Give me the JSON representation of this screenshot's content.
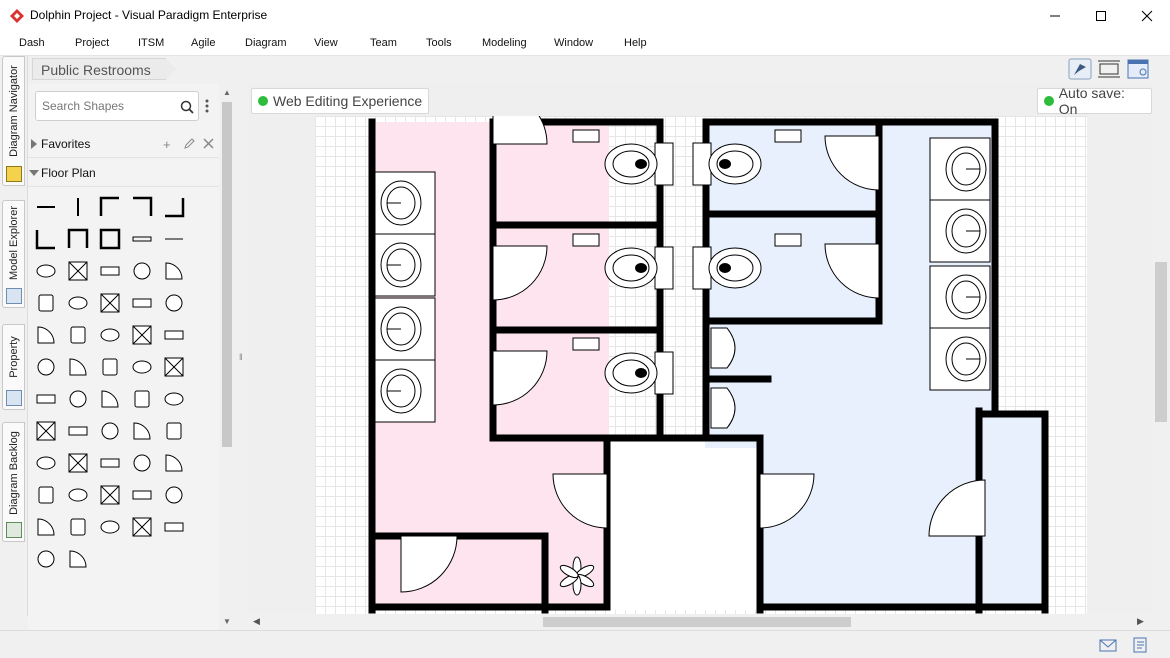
{
  "window": {
    "title": "Dolphin Project - Visual Paradigm Enterprise",
    "accent_color": "#d9332e"
  },
  "menu": [
    "Dash",
    "Project",
    "ITSM",
    "Agile",
    "Diagram",
    "View",
    "Team",
    "Tools",
    "Modeling",
    "Window",
    "Help"
  ],
  "breadcrumb": {
    "diagram": "Public Restrooms"
  },
  "vertical_tabs": [
    "Diagram Navigator",
    "Model Explorer",
    "Property",
    "Diagram Backlog"
  ],
  "shape_panel": {
    "search_placeholder": "Search Shapes",
    "sections": [
      {
        "title": "Favorites",
        "expanded": false
      },
      {
        "title": "Floor Plan",
        "expanded": true
      }
    ],
    "shape_count": 57
  },
  "canvas": {
    "status_pill": "Web Editing Experience",
    "autosave_pill": "Auto save: On",
    "status_color": "#2dbd3a",
    "colors": {
      "womens_area": "#fde4ee",
      "mens_area": "#e8f0fd",
      "walls": "#000000"
    }
  },
  "statusbar": {
    "icons": [
      "mail-icon",
      "notes-icon"
    ]
  }
}
